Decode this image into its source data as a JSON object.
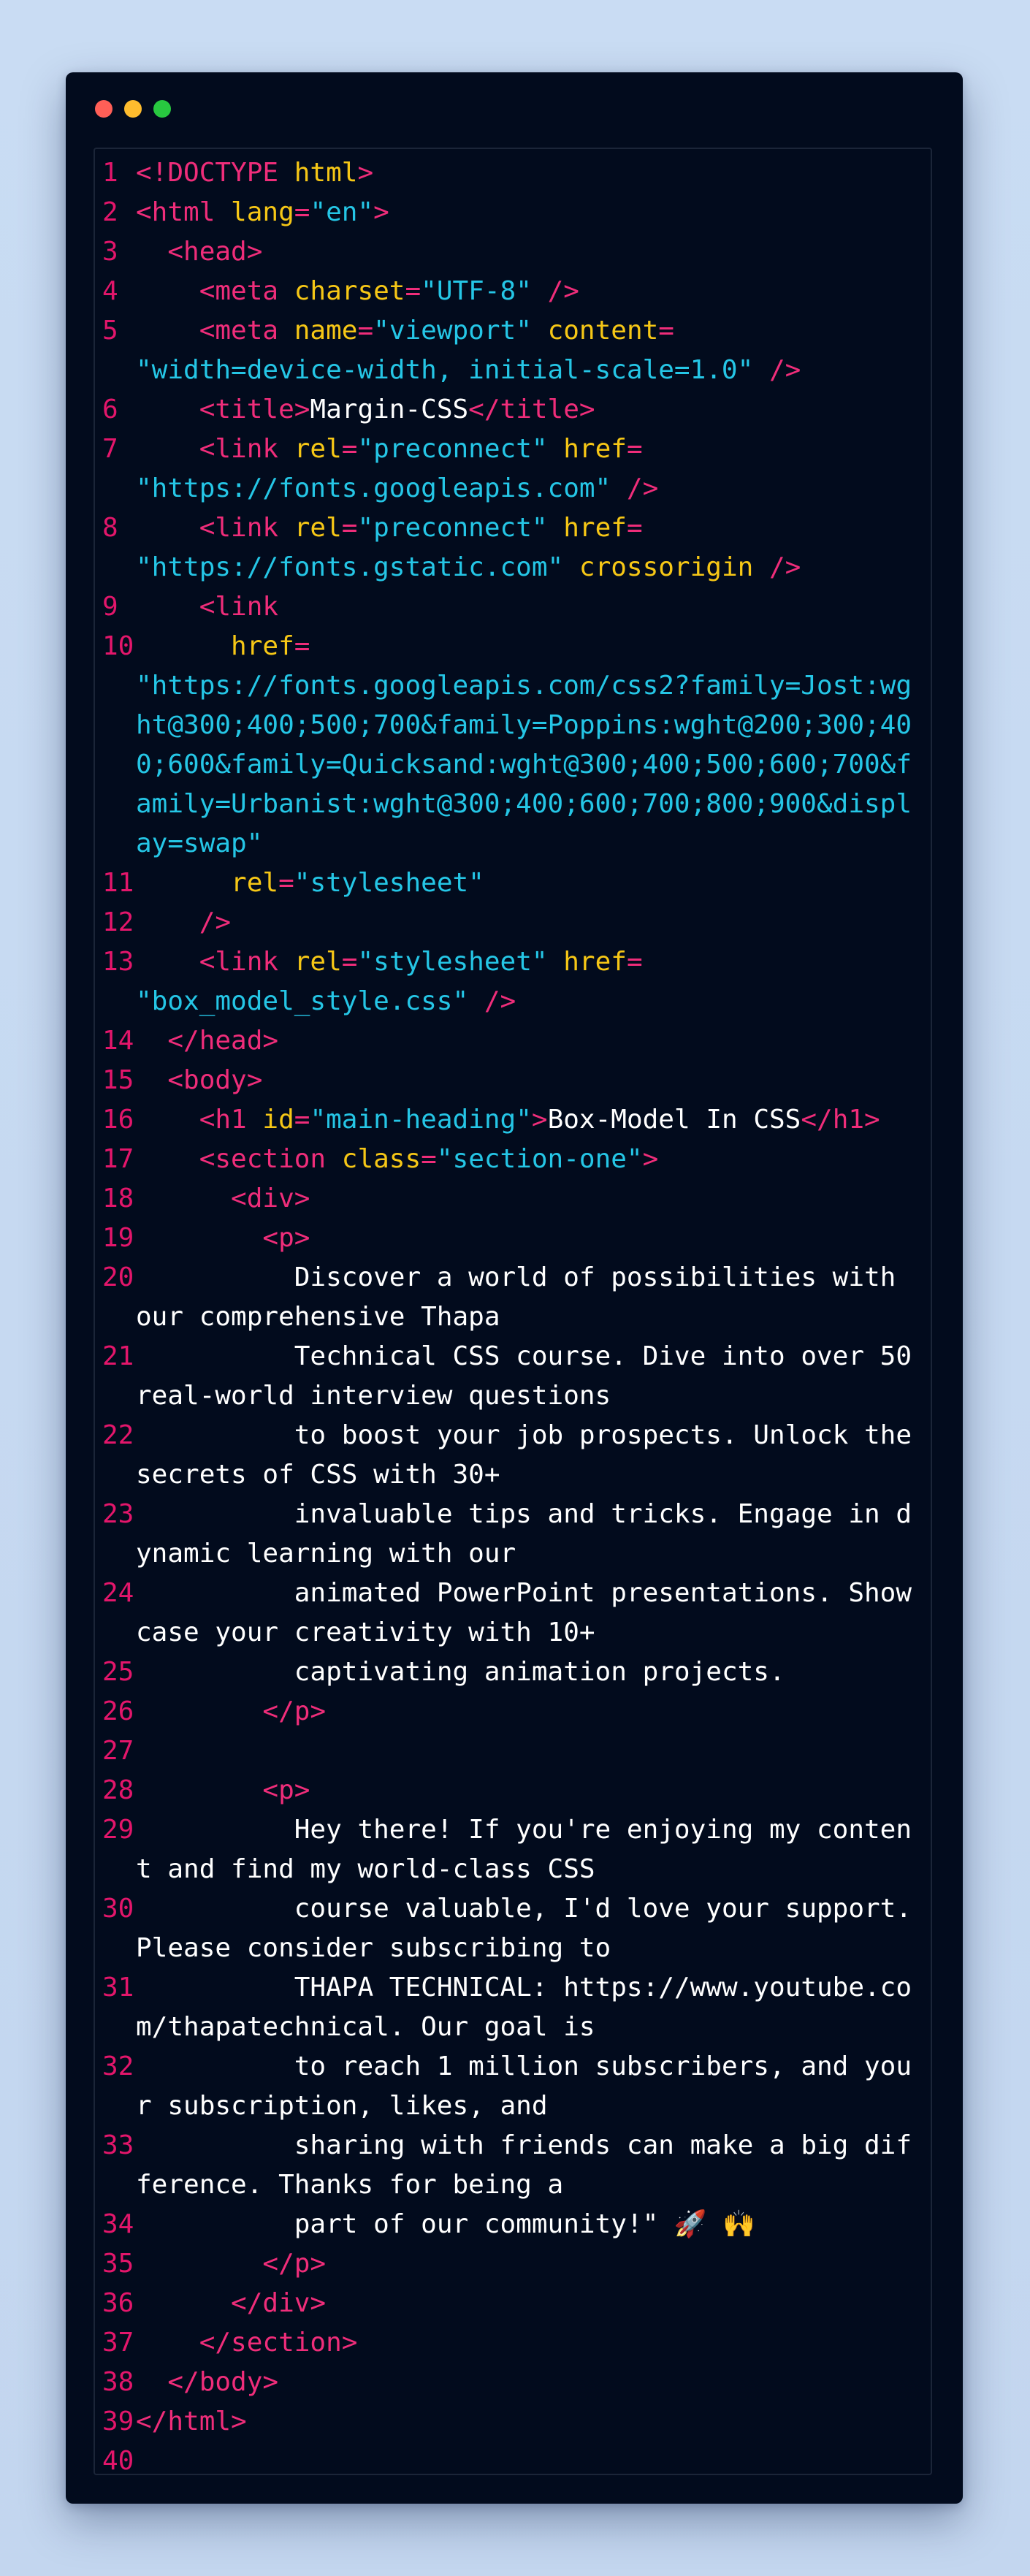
{
  "window": {
    "controls": [
      "close",
      "minimize",
      "maximize"
    ],
    "colors": {
      "close": "#ff5f57",
      "minimize": "#febc2e",
      "maximize": "#28c840",
      "background": "#020b1d",
      "tag": "#ef2d7a",
      "attribute": "#f6c716",
      "string": "#25c6e6",
      "text": "#ffffff",
      "line_number": "#e3166b"
    }
  },
  "code": {
    "lines": [
      [
        [
          "t",
          "<!DOCTYPE "
        ],
        [
          "a",
          "html"
        ],
        [
          "t",
          ">"
        ]
      ],
      [
        [
          "t",
          "<html "
        ],
        [
          "a",
          "lang"
        ],
        [
          "t",
          "="
        ],
        [
          "s",
          "\"en\""
        ],
        [
          "t",
          ">"
        ]
      ],
      [
        [
          "x",
          "  "
        ],
        [
          "t",
          "<head>"
        ]
      ],
      [
        [
          "x",
          "    "
        ],
        [
          "t",
          "<meta "
        ],
        [
          "a",
          "charset"
        ],
        [
          "t",
          "="
        ],
        [
          "s",
          "\"UTF-8\""
        ],
        [
          "x",
          " "
        ],
        [
          "t",
          "/>"
        ]
      ],
      [
        [
          "x",
          "    "
        ],
        [
          "t",
          "<meta "
        ],
        [
          "a",
          "name"
        ],
        [
          "t",
          "="
        ],
        [
          "s",
          "\"viewport\""
        ],
        [
          "x",
          " "
        ],
        [
          "a",
          "content"
        ],
        [
          "t",
          "="
        ],
        [
          "x",
          "\n"
        ],
        [
          "s",
          "\"width=device-width, initial-scale=1.0\""
        ],
        [
          "x",
          " "
        ],
        [
          "t",
          "/>"
        ]
      ],
      [
        [
          "x",
          "    "
        ],
        [
          "t",
          "<title>"
        ],
        [
          "x",
          "Margin-CSS"
        ],
        [
          "t",
          "</title>"
        ]
      ],
      [
        [
          "x",
          "    "
        ],
        [
          "t",
          "<link "
        ],
        [
          "a",
          "rel"
        ],
        [
          "t",
          "="
        ],
        [
          "s",
          "\"preconnect\""
        ],
        [
          "x",
          " "
        ],
        [
          "a",
          "href"
        ],
        [
          "t",
          "="
        ],
        [
          "x",
          "\n"
        ],
        [
          "s",
          "\"https://fonts.googleapis.com\""
        ],
        [
          "x",
          " "
        ],
        [
          "t",
          "/>"
        ]
      ],
      [
        [
          "x",
          "    "
        ],
        [
          "t",
          "<link "
        ],
        [
          "a",
          "rel"
        ],
        [
          "t",
          "="
        ],
        [
          "s",
          "\"preconnect\""
        ],
        [
          "x",
          " "
        ],
        [
          "a",
          "href"
        ],
        [
          "t",
          "="
        ],
        [
          "x",
          "\n"
        ],
        [
          "s",
          "\"https://fonts.gstatic.com\""
        ],
        [
          "x",
          " "
        ],
        [
          "a",
          "crossorigin"
        ],
        [
          "x",
          " "
        ],
        [
          "t",
          "/>"
        ]
      ],
      [
        [
          "x",
          "    "
        ],
        [
          "t",
          "<link"
        ]
      ],
      [
        [
          "x",
          "      "
        ],
        [
          "a",
          "href"
        ],
        [
          "t",
          "="
        ],
        [
          "x",
          "\n"
        ],
        [
          "s",
          "\"https://fonts.googleapis.com/css2?family=Jost:wght@300;400;500;700&family=Poppins:wght@200;300;400;600&family=Quicksand:wght@300;400;500;600;700&family=Urbanist:wght@300;400;600;700;800;900&display=swap\""
        ]
      ],
      [
        [
          "x",
          "      "
        ],
        [
          "a",
          "rel"
        ],
        [
          "t",
          "="
        ],
        [
          "s",
          "\"stylesheet\""
        ]
      ],
      [
        [
          "x",
          "    "
        ],
        [
          "t",
          "/>"
        ]
      ],
      [
        [
          "x",
          "    "
        ],
        [
          "t",
          "<link "
        ],
        [
          "a",
          "rel"
        ],
        [
          "t",
          "="
        ],
        [
          "s",
          "\"stylesheet\""
        ],
        [
          "x",
          " "
        ],
        [
          "a",
          "href"
        ],
        [
          "t",
          "="
        ],
        [
          "x",
          "\n"
        ],
        [
          "s",
          "\"box_model_style.css\""
        ],
        [
          "x",
          " "
        ],
        [
          "t",
          "/>"
        ]
      ],
      [
        [
          "x",
          "  "
        ],
        [
          "t",
          "</head>"
        ]
      ],
      [
        [
          "x",
          "  "
        ],
        [
          "t",
          "<body>"
        ]
      ],
      [
        [
          "x",
          "    "
        ],
        [
          "t",
          "<h1 "
        ],
        [
          "a",
          "id"
        ],
        [
          "t",
          "="
        ],
        [
          "s",
          "\"main-heading\""
        ],
        [
          "t",
          ">"
        ],
        [
          "x",
          "Box-Model In CSS"
        ],
        [
          "t",
          "</h1>"
        ]
      ],
      [
        [
          "x",
          "    "
        ],
        [
          "t",
          "<section "
        ],
        [
          "a",
          "class"
        ],
        [
          "t",
          "="
        ],
        [
          "s",
          "\"section-one\""
        ],
        [
          "t",
          ">"
        ]
      ],
      [
        [
          "x",
          "      "
        ],
        [
          "t",
          "<div>"
        ]
      ],
      [
        [
          "x",
          "        "
        ],
        [
          "t",
          "<p>"
        ]
      ],
      [
        [
          "x",
          "          Discover a world of possibilities with our comprehensive Thapa"
        ]
      ],
      [
        [
          "x",
          "          Technical CSS course. Dive into over 50 real-world interview questions"
        ]
      ],
      [
        [
          "x",
          "          to boost your job prospects. Unlock the secrets of CSS with 30+"
        ]
      ],
      [
        [
          "x",
          "          invaluable tips and tricks. Engage in dynamic learning with our"
        ]
      ],
      [
        [
          "x",
          "          animated PowerPoint presentations. Showcase your creativity with 10+"
        ]
      ],
      [
        [
          "x",
          "          captivating animation projects."
        ]
      ],
      [
        [
          "x",
          "        "
        ],
        [
          "t",
          "</p>"
        ]
      ],
      [],
      [
        [
          "x",
          "        "
        ],
        [
          "t",
          "<p>"
        ]
      ],
      [
        [
          "x",
          "          Hey there! If you're enjoying my content and find my world-class CSS"
        ]
      ],
      [
        [
          "x",
          "          course valuable, I'd love your support. Please consider subscribing to"
        ]
      ],
      [
        [
          "x",
          "          THAPA TECHNICAL: https://www.youtube.com/thapatechnical. Our goal is"
        ]
      ],
      [
        [
          "x",
          "          to reach 1 million subscribers, and your subscription, likes, and"
        ]
      ],
      [
        [
          "x",
          "          sharing with friends can make a big difference. Thanks for being a"
        ]
      ],
      [
        [
          "x",
          "          part of our community!\" 🚀 🙌"
        ]
      ],
      [
        [
          "x",
          "        "
        ],
        [
          "t",
          "</p>"
        ]
      ],
      [
        [
          "x",
          "      "
        ],
        [
          "t",
          "</div>"
        ]
      ],
      [
        [
          "x",
          "    "
        ],
        [
          "t",
          "</section>"
        ]
      ],
      [
        [
          "x",
          "  "
        ],
        [
          "t",
          "</body>"
        ]
      ],
      [
        [
          "t",
          "</html>"
        ]
      ],
      []
    ]
  }
}
